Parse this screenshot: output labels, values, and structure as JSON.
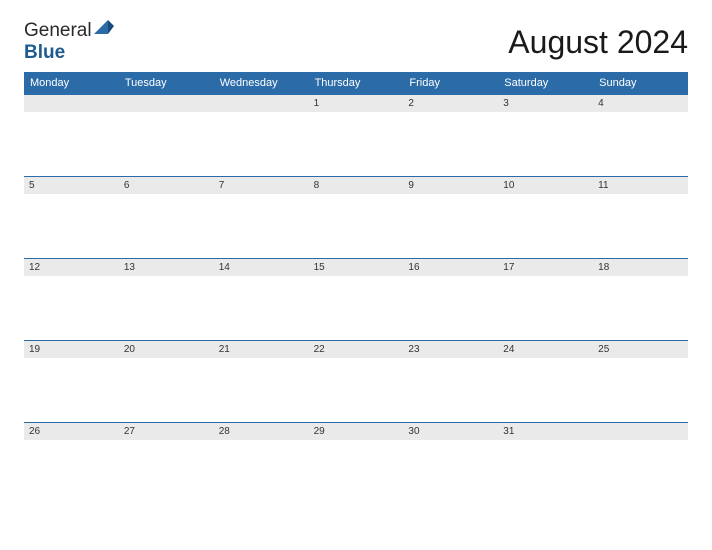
{
  "logo": {
    "text_general": "General",
    "text_blue": "Blue"
  },
  "title": "August 2024",
  "weekdays": [
    "Monday",
    "Tuesday",
    "Wednesday",
    "Thursday",
    "Friday",
    "Saturday",
    "Sunday"
  ],
  "weeks": [
    [
      "",
      "",
      "",
      "1",
      "2",
      "3",
      "4"
    ],
    [
      "5",
      "6",
      "7",
      "8",
      "9",
      "10",
      "11"
    ],
    [
      "12",
      "13",
      "14",
      "15",
      "16",
      "17",
      "18"
    ],
    [
      "19",
      "20",
      "21",
      "22",
      "23",
      "24",
      "25"
    ],
    [
      "26",
      "27",
      "28",
      "29",
      "30",
      "31",
      ""
    ]
  ]
}
